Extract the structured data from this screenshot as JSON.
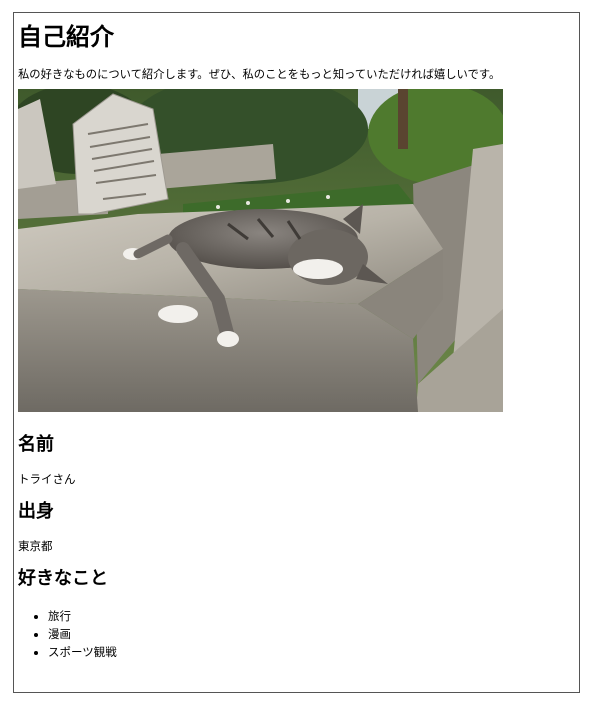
{
  "page": {
    "title": "自己紹介",
    "intro": "私の好きなものについて紹介します。ぜひ、私のことをもっと知っていただければ嬉しいです。",
    "photo_subject": "cat sleeping on a stone ledge in a cemetery"
  },
  "sections": {
    "name": {
      "heading": "名前",
      "value": "トライさん"
    },
    "origin": {
      "heading": "出身",
      "value": "東京都"
    },
    "likes": {
      "heading": "好きなこと",
      "items": [
        "旅行",
        "漫画",
        "スポーツ観戦"
      ]
    }
  }
}
